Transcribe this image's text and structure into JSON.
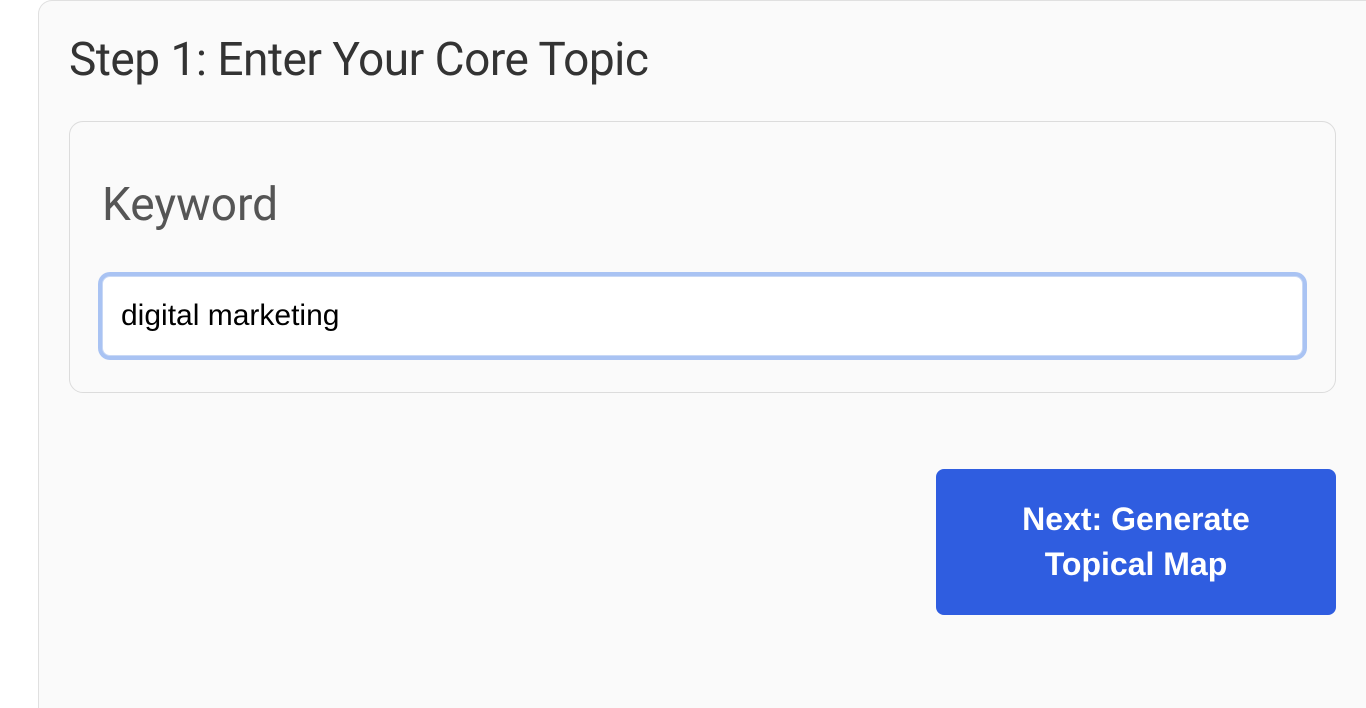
{
  "step": {
    "title": "Step 1: Enter Your Core Topic"
  },
  "form": {
    "keyword_label": "Keyword",
    "keyword_value": "digital marketing"
  },
  "actions": {
    "next_label": "Next: Generate Topical Map"
  }
}
